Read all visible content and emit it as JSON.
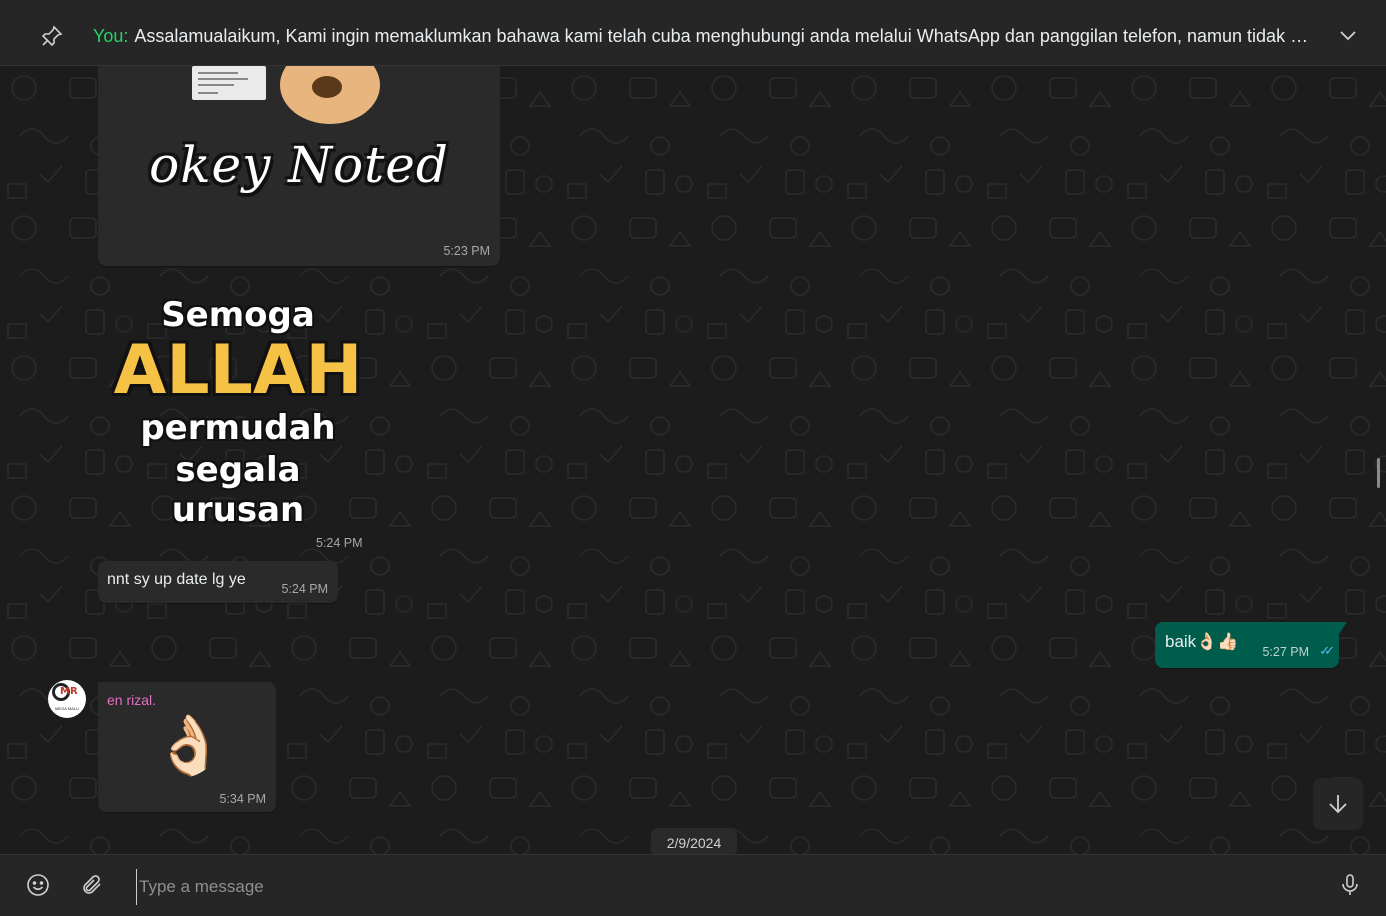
{
  "pinned": {
    "sender_label": "You:",
    "text": "Assalamualaikum,  Kami ingin memaklumkan bahawa kami telah cuba menghubungi anda melalui WhatsApp dan panggilan telefon, namun tidak mener..."
  },
  "messages": {
    "sticker1": {
      "text": "okey  Noted",
      "time": "5:23 PM"
    },
    "sticker2": {
      "line1": "Semoga",
      "line2": "ALLAH",
      "line3": "permudah",
      "line4": "segala urusan",
      "time": "5:24 PM"
    },
    "incoming_text": {
      "text": "nnt sy up date lg ye",
      "time": "5:24 PM"
    },
    "outgoing_text": {
      "text": "baik👌🏻👍🏻",
      "time": "5:27 PM",
      "ticks": "✓✓"
    },
    "emoji_msg": {
      "sender": "en rizal.",
      "emoji": "👌🏻",
      "time": "5:34 PM"
    }
  },
  "avatar": {
    "mark": "MR",
    "sub": "MEGA MALU"
  },
  "date_chip": "2/9/2024",
  "composer": {
    "placeholder": "Type a message"
  },
  "colors": {
    "accent": "#25d366",
    "outgoing_bubble": "#005c4b",
    "incoming_bubble": "#2a2a2a",
    "sender_name": "#e26fc0"
  }
}
